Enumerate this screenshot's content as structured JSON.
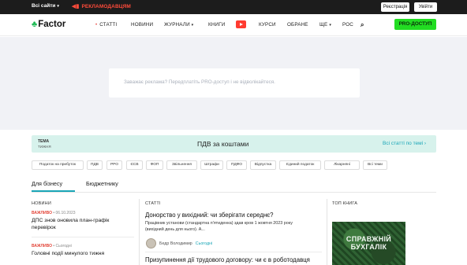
{
  "topbar": {
    "sites_label": "Всі сайти",
    "advertisers_label": "РЕКЛАМОДАВЦЯМ",
    "register_label": "Реєстрація",
    "login_label": "Увійти"
  },
  "nav": {
    "logo_text": "Factor",
    "items": [
      "СТАТТІ",
      "НОВИНИ",
      "ЖУРНАЛИ",
      "КНИГИ",
      "КУРСИ",
      "ОБРАНЕ",
      "ЩЕ",
      "РОС"
    ],
    "pro_label": "PRO-ДОСТУП",
    "icons": [
      "youtube-icon",
      "search-icon"
    ]
  },
  "ad": {
    "message": "Заважає реклама? Передплатіть PRO-доступ і не відволікайтеся."
  },
  "topic": {
    "label_line1": "ТЕМА",
    "label_line2": "ТИЖНЯ",
    "title": "ПДВ за коштами",
    "all_link": "Всі статті по темі ›"
  },
  "chips": [
    "Податок на прибуток",
    "ПДВ",
    "РРО",
    "ЄСВ",
    "ФОП",
    "Звільнення",
    "Штрафи",
    "ПДФО",
    "Відпустка",
    "Єдиний податок",
    "Лікарняні",
    "Всі теми"
  ],
  "tabs": [
    "Для бізнесу",
    "Бюджетнику"
  ],
  "news": {
    "heading": "НОВИНИ",
    "items": [
      {
        "tag": "ВАЖЛИВО",
        "date": "06.10.2023",
        "title_l1": "ДПС знов оновила план-графік",
        "title_l2": "перевірок"
      },
      {
        "tag": "ВАЖЛИВО",
        "date": "Сьогодні",
        "title_l1": "Головні події минулого тижня",
        "title_l2": ""
      }
    ]
  },
  "articles": {
    "heading": "СТАТТІ",
    "items": [
      {
        "title": "Донорство у вихідний: чи зберігати середнє?",
        "lead_l1": "Працівник установи (стандартна п'ятиденка) здав кров 1 жовтня 2023 року",
        "lead_l2": "(вихідний день для нього). А...",
        "author": "Бедр Володимир",
        "when": "Сьогодні"
      },
      {
        "title": "Призупинення дії трудового договору: чи є в роботодавця",
        "lead_l1": "",
        "lead_l2": "",
        "author": "",
        "when": ""
      }
    ]
  },
  "book": {
    "heading": "ТОП КНИГА",
    "cover_line1": "СПРАВЖНІЙ",
    "cover_line2": "БУХГАЛІК"
  },
  "colors": {
    "accent": "#1aa6b7",
    "pro_green": "#22dd22",
    "alert_red": "#e3463a",
    "topbar_bg": "#1c1c1c",
    "topic_bg": "#d7f2ec"
  }
}
